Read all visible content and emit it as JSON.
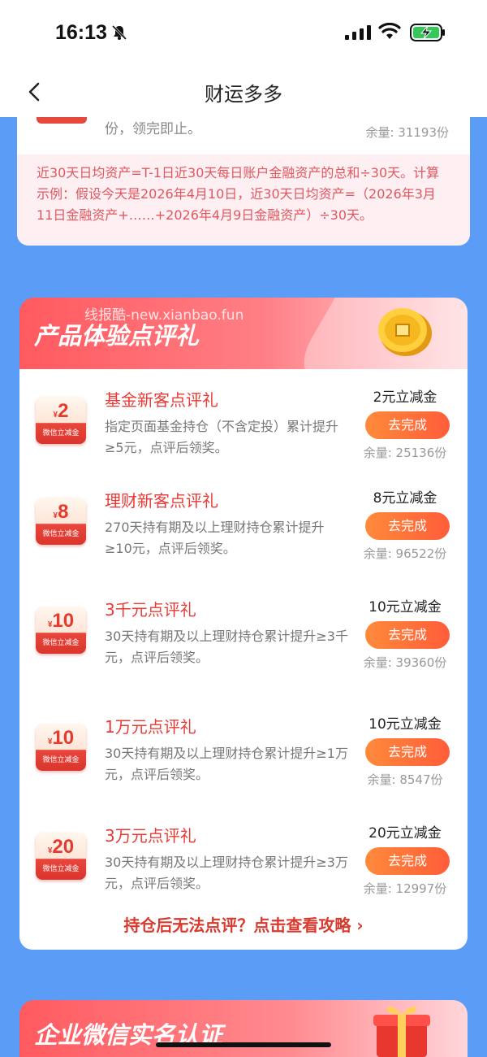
{
  "status": {
    "time": "16:13"
  },
  "nav": {
    "title": "财运多多"
  },
  "top_card": {
    "desc_tail": "份，领完即止。",
    "stock": "余量: 31193份",
    "note": "近30天日均资产=T-1日近30天每日账户金融资产的总和÷30天。计算示例：假设今天是2026年4月10日，近30天日均资产=（2026年3月11日金融资产+……+2026年4月9日金融资产）÷30天。"
  },
  "product_section": {
    "title": "产品体验点评礼",
    "watermark": "线报酷-new.xianbao.fun",
    "items": [
      {
        "badge_amount": "2",
        "badge_label": "微信立减金",
        "title": "基金新客点评礼",
        "desc": "指定页面基金持仓（不含定投）累计提升≥5元，点评后领奖。",
        "reward": "2元立减金",
        "button": "去完成",
        "stock": "余量: 25136份"
      },
      {
        "badge_amount": "8",
        "badge_label": "微信立减金",
        "title": "理财新客点评礼",
        "desc": "270天持有期及以上理财持仓累计提升≥10元，点评后领奖。",
        "reward": "8元立减金",
        "button": "去完成",
        "stock": "余量: 96522份"
      },
      {
        "badge_amount": "10",
        "badge_label": "微信立减金",
        "title": "3千元点评礼",
        "desc": "30天持有期及以上理财持仓累计提升≥3千元，点评后领奖。",
        "reward": "10元立减金",
        "button": "去完成",
        "stock": "余量: 39360份"
      },
      {
        "badge_amount": "10",
        "badge_label": "微信立减金",
        "title": "1万元点评礼",
        "desc": "30天持有期及以上理财持仓累计提升≥1万元，点评后领奖。",
        "reward": "10元立减金",
        "button": "去完成",
        "stock": "余量: 8547份"
      },
      {
        "badge_amount": "20",
        "badge_label": "微信立减金",
        "title": "3万元点评礼",
        "desc": "30天持有期及以上理财持仓累计提升≥3万元，点评后领奖。",
        "reward": "20元立减金",
        "button": "去完成",
        "stock": "余量: 12997份"
      }
    ],
    "guide_link": "持仓后无法点评？点击查看攻略 ›"
  },
  "enterprise_section": {
    "title": "企业微信实名认证"
  },
  "colors": {
    "accent_red": "#ea3a35",
    "button_orange": "#ff6a3a",
    "page_blue": "#5b9cf6"
  },
  "icons": [
    "bell-slash-icon",
    "signal-icon",
    "wifi-icon",
    "battery-charging-icon",
    "back-arrow-icon",
    "coin-icon",
    "gift-icon"
  ]
}
